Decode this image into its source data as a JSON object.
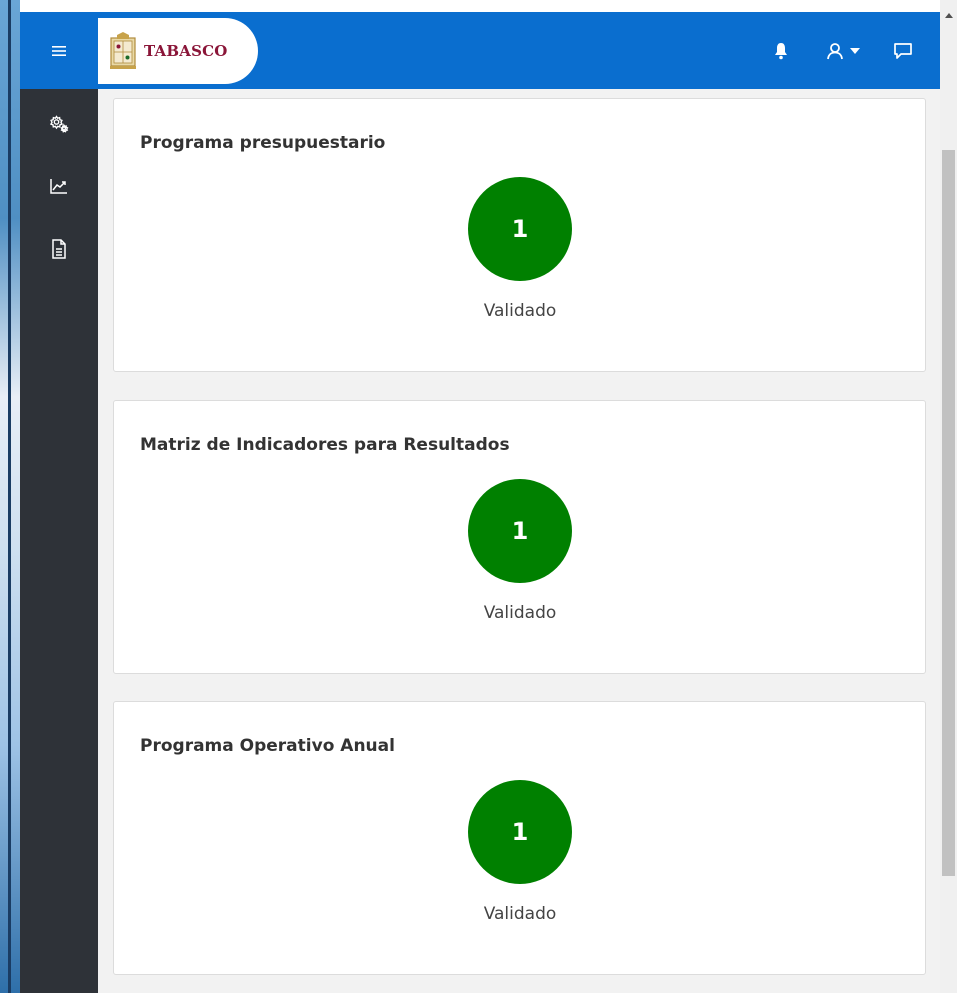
{
  "header": {
    "logo_text": "TABASCO",
    "menu_icon": "hamburger-icon",
    "notifications_icon": "bell-icon",
    "user_icon": "user-icon",
    "user_caret_icon": "caret-down-icon",
    "chat_icon": "chat-icon",
    "brand_color": "#0a6ecf",
    "logo_text_color": "#8a1538"
  },
  "sidebar": {
    "items": [
      {
        "icon": "gears-icon"
      },
      {
        "icon": "trend-chart-icon"
      },
      {
        "icon": "document-icon"
      }
    ],
    "background": "#2e3238"
  },
  "cards": [
    {
      "title": "Programa presupuestario",
      "count": "1",
      "status": "Validado"
    },
    {
      "title": "Matriz de Indicadores para Resultados",
      "count": "1",
      "status": "Validado"
    },
    {
      "title": "Programa Operativo Anual",
      "count": "1",
      "status": "Validado"
    }
  ],
  "badge_color": "#008000"
}
